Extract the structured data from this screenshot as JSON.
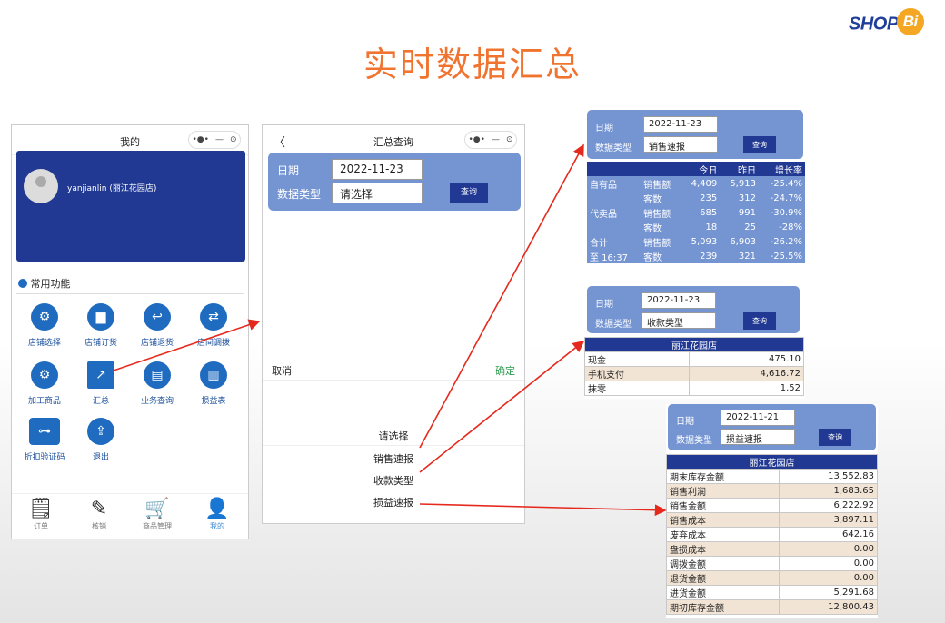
{
  "logo": {
    "text": "SHOP",
    "bi": "Bi"
  },
  "title": "实时数据汇总",
  "phone1": {
    "bar_title": "我的",
    "capsule_dots": "•●•",
    "capsule_min": "—",
    "capsule_close": "⊙",
    "user": "yanjianlin (丽江花园店)",
    "section": "常用功能",
    "functions": [
      "店铺选择",
      "店铺订货",
      "店铺退货",
      "店间调拨",
      "加工商品",
      "汇总",
      "业务查询",
      "损益表",
      "折扣验证码",
      "退出"
    ],
    "tabs": [
      "订单",
      "核销",
      "商品管理",
      "我的"
    ]
  },
  "phone2": {
    "bar_back": "〈",
    "bar_title": "汇总查询",
    "date_label": "日期",
    "date_value": "2022-11-23",
    "type_label": "数据类型",
    "type_value": "请选择",
    "query": "查询",
    "cancel": "取消",
    "confirm": "确定",
    "options": [
      "请选择",
      "销售速报",
      "收款类型",
      "损益速报"
    ]
  },
  "card1": {
    "date_label": "日期",
    "date_value": "2022-11-23",
    "type_label": "数据类型",
    "type_value": "销售速报",
    "query": "查询",
    "headers": [
      "",
      "",
      "今日",
      "昨日",
      "增长率"
    ],
    "rows": [
      [
        "自有品",
        "销售额",
        "4,409",
        "5,913",
        "-25.4%"
      ],
      [
        "",
        "客数",
        "235",
        "312",
        "-24.7%"
      ],
      [
        "代卖品",
        "销售额",
        "685",
        "991",
        "-30.9%"
      ],
      [
        "",
        "客数",
        "18",
        "25",
        "-28%"
      ],
      [
        "合计",
        "销售额",
        "5,093",
        "6,903",
        "-26.2%"
      ],
      [
        "至 16:37",
        "客数",
        "239",
        "321",
        "-25.5%"
      ]
    ]
  },
  "card2": {
    "date_label": "日期",
    "date_value": "2022-11-23",
    "type_label": "数据类型",
    "type_value": "收款类型",
    "query": "查询",
    "store": "丽江花园店",
    "rows": [
      [
        "现金",
        "475.10"
      ],
      [
        "手机支付",
        "4,616.72"
      ],
      [
        "抹零",
        "1.52"
      ]
    ]
  },
  "card3": {
    "date_label": "日期",
    "date_value": "2022-11-21",
    "type_label": "数据类型",
    "type_value": "损益速报",
    "query": "查询",
    "store": "丽江花园店",
    "rows": [
      [
        "期末库存金额",
        "13,552.83"
      ],
      [
        "销售利润",
        "1,683.65"
      ],
      [
        "销售金额",
        "6,222.92"
      ],
      [
        "销售成本",
        "3,897.11"
      ],
      [
        "废弃成本",
        "642.16"
      ],
      [
        "盘损成本",
        "0.00"
      ],
      [
        "调拨金额",
        "0.00"
      ],
      [
        "退货金额",
        "0.00"
      ],
      [
        "进货金额",
        "5,291.68"
      ],
      [
        "期初库存金额",
        "12,800.43"
      ]
    ]
  },
  "colors": {
    "title": "#f0742f",
    "navy": "#213993",
    "panel": "#7494d2",
    "beige": "#f2e4d4",
    "arrow": "#e52a1d"
  }
}
